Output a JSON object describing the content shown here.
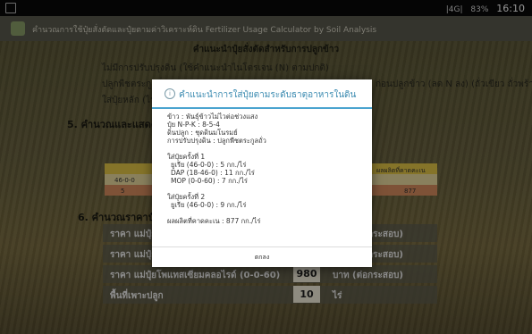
{
  "status_bar": {
    "signal": "|4G|",
    "battery": "83%",
    "time": "16:10"
  },
  "app_bar": {
    "title": "คำนวณการใช้ปุ๋ยสั่งตัดและปุ๋ยตามค่าวิเคราะห์ดิน Fertilizer Usage Calculator by Soil Analysis"
  },
  "background": {
    "section_title": "คำแนะนำปุ๋ยสั่งตัดสำหรับการปลูกข้าว",
    "line1": "ไม่มีการปรับปรุงดิน (ใช้คำแนะนำไนโตรเจน (N) ตามปกติ)",
    "line2": "ปลูกพืชตระกูลถั่ว",
    "line2_tail": "ก่อนปลูกข้าว (ลด N ลง) (ถั่วเขียว ถั่วพร้า หรือ ต่ำ)",
    "line3": "ใส่ปุ๋ยหลัก (ไนโตรเจน)",
    "heading5": "5. คำนวณและแสดงคำแนะนำ",
    "table": {
      "col_left": "46-0-0",
      "col_right_header": "ผลผลิตที่คาดคะเน",
      "val_left": "5",
      "val_right": "877"
    },
    "heading6": "6. คำนวณราคาปุ๋ย",
    "prices": [
      {
        "label": "ราคา แม่ปุ๋ยยูเรีย (46-0-0)",
        "value": "",
        "unit": "บาท (ต่อกระสอบ)"
      },
      {
        "label": "ราคา แม่ปุ๋ยไดแอมโมเนียมฟอสเฟต (18-46-0)",
        "value": "",
        "unit": "บาท (ต่อกระสอบ)"
      },
      {
        "label": "ราคา แม่ปุ๋ยโพแทสเซียมคลอไรด์ (0-0-60)",
        "value": "980",
        "unit": "บาท (ต่อกระสอบ)"
      },
      {
        "label": "พื้นที่เพาะปลูก",
        "value": "10",
        "unit": "ไร่"
      }
    ]
  },
  "dialog": {
    "title": "คำแนะนำการใส่ปุ๋ยตามระดับธาตุอาหารในดิน",
    "info_lines": [
      "ข้าว : พันธุ์ข้าวไม่ไวต่อช่วงแสง",
      "ปุ๋ย N-P-K : 8-5-4",
      "ดินปลูก : ชุดดินมโนรมย์",
      "การปรับปรุงดิน : ปลูกพืชตระกูลถั่ว"
    ],
    "first_application": {
      "heading": "ใส่ปุ๋ยครั้งที่ 1",
      "items": [
        "ยูเรีย (46-0-0) : 5 กก./ไร่",
        "DAP (18-46-0) : 11 กก./ไร่",
        "MOP (0-0-60) : 7 กก./ไร่"
      ]
    },
    "second_application": {
      "heading": "ใส่ปุ๋ยครั้งที่ 2",
      "items": [
        "ยูเรีย (46-0-0) : 9 กก./ไร่"
      ]
    },
    "expected_yield": "ผลผลิตที่คาดคะเน : 877 กก./ไร่",
    "ok_label": "ตกลง"
  }
}
